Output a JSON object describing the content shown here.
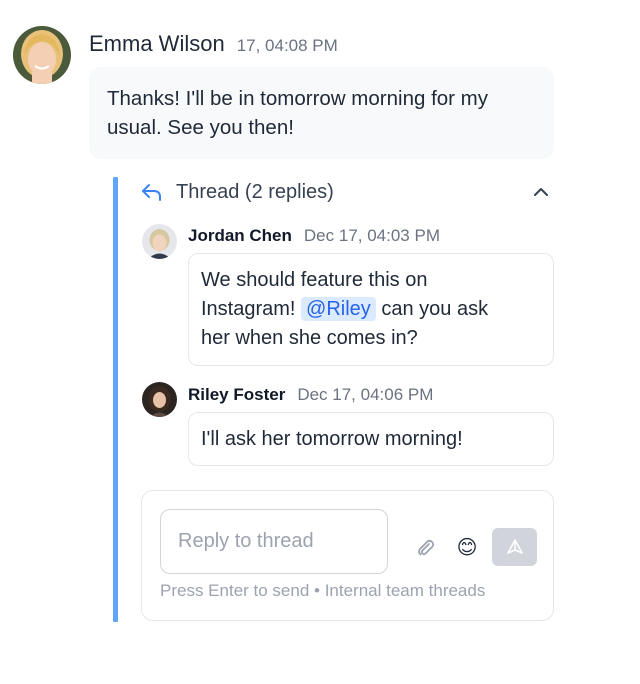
{
  "main_message": {
    "author": "Emma Wilson",
    "timestamp": "17, 04:08 PM",
    "text_line1": "Thanks! I'll be in tomorrow morning for my",
    "text_line2": "usual. See you then!"
  },
  "thread": {
    "title": "Thread (2 replies)",
    "replies": [
      {
        "author": "Jordan Chen",
        "timestamp": "Dec 17, 04:03 PM",
        "line1": "We should feature this on",
        "line2_before": "Instagram!",
        "mention": "@Riley",
        "line2_after": "can you ask",
        "line3": "her when she comes in?"
      },
      {
        "author": "Riley Foster",
        "timestamp": "Dec 17, 04:06 PM",
        "text": "I'll ask her tomorrow morning!"
      }
    ]
  },
  "composer": {
    "placeholder": "Reply to thread",
    "emoji": "😊",
    "hint": "Press Enter to send • Internal team threads"
  },
  "icons": {
    "reply": "reply-arrow-icon",
    "collapse": "chevron-up-icon",
    "attach": "paperclip-icon",
    "emoji": "smiley-emoji-icon",
    "send": "send-icon"
  },
  "colors": {
    "accent": "#60a5fa",
    "mention_bg": "#dbeafe",
    "mention_text": "#2563eb",
    "send_disabled": "#d1d5db"
  }
}
